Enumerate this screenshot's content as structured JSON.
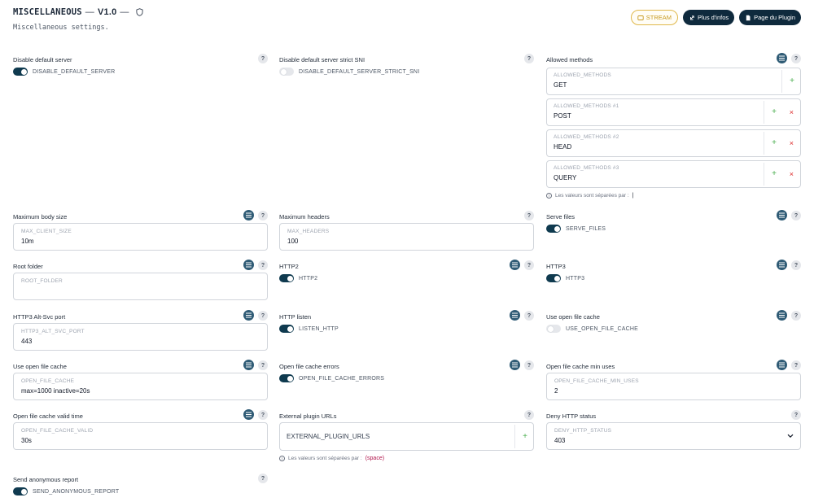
{
  "header": {
    "plugin_name": "MISCELLANEOUS",
    "dash1": "—",
    "version": "V1.0",
    "dash2": "—",
    "subtitle": "Miscellaneous settings."
  },
  "buttons": {
    "stream": "STREAM",
    "more_info": "Plus d'infos",
    "plugin_page": "Page du Plugin"
  },
  "settings": {
    "disable_default_server": {
      "label": "Disable default server",
      "toggle_text": "DISABLE_DEFAULT_SERVER",
      "enabled": true
    },
    "disable_default_server_strict_sni": {
      "label": "Disable default server strict SNI",
      "toggle_text": "DISABLE_DEFAULT_SERVER_STRICT_SNI",
      "enabled": false
    },
    "allowed_methods": {
      "label": "Allowed methods",
      "rows": [
        {
          "placeholder": "ALLOWED_METHODS",
          "value": "GET"
        },
        {
          "placeholder": "ALLOWED_METHODS #1",
          "value": "POST"
        },
        {
          "placeholder": "ALLOWED_METHODS #2",
          "value": "HEAD"
        },
        {
          "placeholder": "ALLOWED_METHODS #3",
          "value": "QUERY"
        }
      ],
      "note": "Les valeurs sont séparées par :",
      "separator": "|"
    },
    "max_body_size": {
      "label": "Maximum body size",
      "placeholder": "MAX_CLIENT_SIZE",
      "value": "10m"
    },
    "max_headers": {
      "label": "Maximum headers",
      "placeholder": "MAX_HEADERS",
      "value": "100"
    },
    "serve_files": {
      "label": "Serve files",
      "toggle_text": "SERVE_FILES",
      "enabled": true
    },
    "root_folder": {
      "label": "Root folder",
      "placeholder": "ROOT_FOLDER",
      "value": ""
    },
    "http2": {
      "label": "HTTP2",
      "toggle_text": "HTTP2",
      "enabled": true
    },
    "http3": {
      "label": "HTTP3",
      "toggle_text": "HTTP3",
      "enabled": true
    },
    "http3_alt_svc_port": {
      "label": "HTTP3 Alt-Svc port",
      "placeholder": "HTTP3_ALT_SVC_PORT",
      "value": "443"
    },
    "http_listen": {
      "label": "HTTP listen",
      "toggle_text": "LISTEN_HTTP",
      "enabled": true
    },
    "use_open_file_cache_toggle": {
      "label": "Use open file cache",
      "toggle_text": "USE_OPEN_FILE_CACHE",
      "enabled": false
    },
    "open_file_cache": {
      "label": "Use open file cache",
      "placeholder": "OPEN_FILE_CACHE",
      "value": "max=1000 inactive=20s"
    },
    "open_file_cache_errors": {
      "label": "Open file cache errors",
      "toggle_text": "OPEN_FILE_CACHE_ERRORS",
      "enabled": true
    },
    "open_file_cache_min_uses": {
      "label": "Open file cache min uses",
      "placeholder": "OPEN_FILE_CACHE_MIN_USES",
      "value": "2"
    },
    "open_file_cache_valid": {
      "label": "Open file cache valid time",
      "placeholder": "OPEN_FILE_CACHE_VALID",
      "value": "30s"
    },
    "external_plugin_urls": {
      "label": "External plugin URLs",
      "placeholder": "EXTERNAL_PLUGIN_URLS",
      "note": "Les valeurs sont séparées par :",
      "separator": "(space)"
    },
    "deny_http_status": {
      "label": "Deny HTTP status",
      "placeholder": "DENY_HTTP_STATUS",
      "value": "403"
    },
    "send_anonymous_report": {
      "label": "Send anonymous report",
      "toggle_text": "SEND_ANONYMOUS_REPORT",
      "enabled": true
    }
  },
  "help_glyph": "?",
  "plus_glyph": "+",
  "cross_glyph": "×",
  "chevron_glyph": "⌄",
  "info_glyph": "i"
}
